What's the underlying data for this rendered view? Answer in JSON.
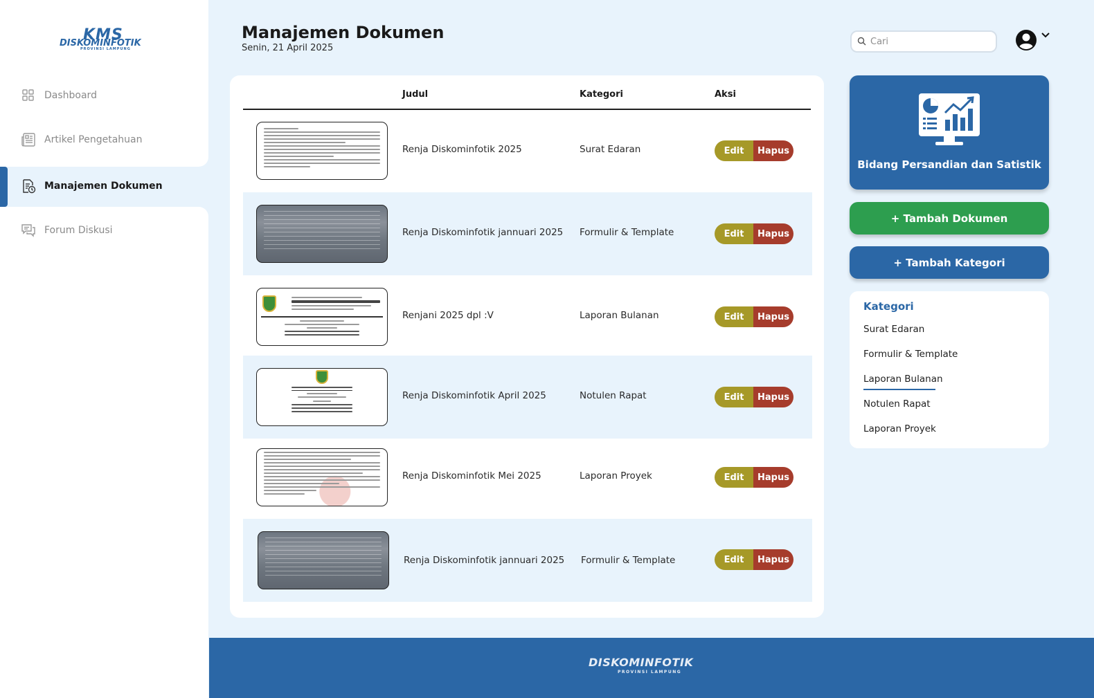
{
  "app": {
    "logo_main": "KMS",
    "logo_sub": "DISKOMINFOTIK",
    "logo_region": "PROVINSI LAMPUNG"
  },
  "sidebar": {
    "items": [
      {
        "label": "Dashboard",
        "icon": "dashboard-icon"
      },
      {
        "label": "Artikel Pengetahuan",
        "icon": "newspaper-icon"
      },
      {
        "label": "Manajemen Dokumen",
        "icon": "document-icon",
        "active": true
      },
      {
        "label": "Forum Diskusi",
        "icon": "chat-icon"
      }
    ]
  },
  "header": {
    "title": "Manajemen Dokumen",
    "date": "Senin, 21 April 2025",
    "search_placeholder": "Cari"
  },
  "table": {
    "columns": {
      "title": "Judul",
      "category": "Kategori",
      "action": "Aksi"
    },
    "edit_label": "Edit",
    "delete_label": "Hapus",
    "rows": [
      {
        "title": "Renja Diskominfotik 2025",
        "category": "Surat Edaran",
        "thumb": "text-document"
      },
      {
        "title": "Renja Diskominfotik jannuari 2025",
        "category": "Formulir & Template",
        "thumb": "photo-form"
      },
      {
        "title": "Renjani 2025 dpl :V",
        "category": "Laporan Bulanan",
        "thumb": "letterhead"
      },
      {
        "title": "Renja Diskominfotik April 2025",
        "category": "Notulen Rapat",
        "thumb": "announcement"
      },
      {
        "title": "Renja Diskominfotik Mei 2025",
        "category": "Laporan Proyek",
        "thumb": "text-document"
      },
      {
        "title": "Renja Diskominfotik jannuari 2025",
        "category": "Formulir & Template",
        "thumb": "photo-form"
      }
    ]
  },
  "right_panel": {
    "stat_card_label": "Bidang Persandian dan Satistik",
    "add_document_label": "+ Tambah Dokumen",
    "add_category_label": "+ Tambah Kategori",
    "categories_title": "Kategori",
    "categories": [
      "Surat Edaran",
      "Formulir & Template",
      "Laporan Bulanan",
      "Notulen Rapat",
      "Laporan Proyek"
    ],
    "selected_category": "Laporan Bulanan"
  },
  "footer": {
    "logo_text": "DISKOMINFOTIK",
    "region": "PROVINSI LAMPUNG"
  },
  "colors": {
    "primary": "#2b67a6",
    "background": "#e8f3fc",
    "edit": "#a69928",
    "delete": "#a63c2c",
    "add_document": "#2d9e4f"
  }
}
